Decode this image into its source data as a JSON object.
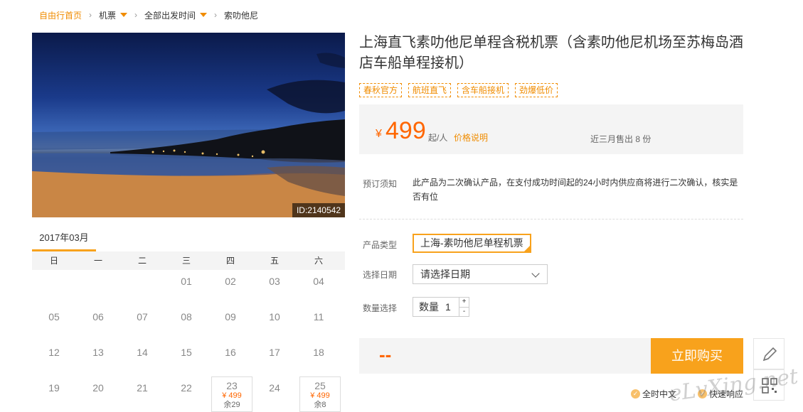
{
  "breadcrumb": [
    {
      "label": "自由行首页",
      "caret": false
    },
    {
      "label": "机票",
      "caret": true
    },
    {
      "label": "全部出发时间",
      "caret": true
    },
    {
      "label": "索叻他尼",
      "caret": false
    }
  ],
  "hero": {
    "id_label": "ID:2140542"
  },
  "product": {
    "title": "上海直飞素叻他尼单程含税机票（含素叻他尼机场至苏梅岛酒店车船单程接机）",
    "tags": [
      "春秋官方",
      "航班直飞",
      "含车船接机",
      "劲爆低价"
    ]
  },
  "price": {
    "currency": "¥",
    "amount": "499",
    "unit": "起/人",
    "note_link": "价格说明",
    "sold": "近三月售出 8 份"
  },
  "notice": {
    "label": "预订须知",
    "text": "此产品为二次确认产品，在支付成功时间起的24小时内供应商将进行二次确认，核实是否有位"
  },
  "options": {
    "type_label": "产品类型",
    "type_value": "上海-素叻他尼单程机票",
    "date_label": "选择日期",
    "date_placeholder": "请选择日期",
    "qty_label": "数量选择",
    "qty_inner_label": "数量",
    "qty_value": "1",
    "plus": "+",
    "minus": "-"
  },
  "buy": {
    "total": "--",
    "button": "立即购买"
  },
  "assurances": [
    "全时中文",
    "快速响应"
  ],
  "watermark": "eLvXing.net",
  "calendar": {
    "month": "2017年03月",
    "weekdays": [
      "日",
      "一",
      "二",
      "三",
      "四",
      "五",
      "六"
    ],
    "rows": [
      [
        "",
        "",
        "",
        "01",
        "02",
        "03",
        "04"
      ],
      [
        "05",
        "06",
        "07",
        "08",
        "09",
        "10",
        "11"
      ],
      [
        "12",
        "13",
        "14",
        "15",
        "16",
        "17",
        "18"
      ],
      [
        "19",
        "20",
        "21",
        "22",
        "23",
        "24",
        "25"
      ]
    ],
    "available": [
      {
        "day": "23",
        "price": "¥ 499",
        "left": "余29"
      },
      {
        "day": "25",
        "price": "¥ 499",
        "left": "余8"
      }
    ]
  },
  "colors": {
    "accent": "#f8a21c",
    "price": "#ff6600"
  }
}
